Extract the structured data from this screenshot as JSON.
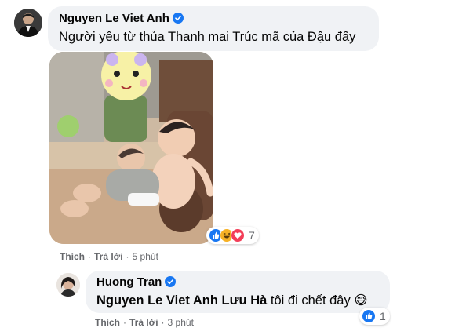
{
  "comments": [
    {
      "author": "Nguyen Le Viet Anh",
      "verified": true,
      "text": "Người yêu từ thủa Thanh mai Trúc mã của Đậu đấy",
      "has_photo": true,
      "reactions": {
        "icons": [
          "like-icon",
          "haha-icon",
          "love-icon"
        ],
        "count": "7"
      },
      "actions": {
        "like": "Thích",
        "reply": "Trả lời",
        "time": "5 phút"
      }
    },
    {
      "author": "Huong Tran",
      "verified": true,
      "mention": "Nguyen Le Viet Anh Lưu Hà",
      "text": "tôi đi chết đây",
      "emoji": "😅",
      "reactions": {
        "icons": [
          "like-icon"
        ],
        "count": "1"
      },
      "actions": {
        "like": "Thích",
        "reply": "Trả lời",
        "time": "3 phút"
      }
    }
  ],
  "colors": {
    "bubble": "#f0f2f5",
    "like_blue": "#1877f2",
    "secondary_text": "#65676b"
  }
}
